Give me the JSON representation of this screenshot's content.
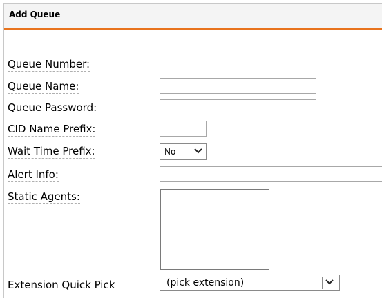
{
  "header": {
    "title": "Add Queue"
  },
  "form": {
    "queue_number": {
      "label": "Queue Number:",
      "value": ""
    },
    "queue_name": {
      "label": "Queue Name:",
      "value": ""
    },
    "queue_password": {
      "label": "Queue Password:",
      "value": ""
    },
    "cid_name_prefix": {
      "label": "CID Name Prefix:",
      "value": ""
    },
    "wait_time_prefix": {
      "label": "Wait Time Prefix:",
      "selected": "No"
    },
    "alert_info": {
      "label": "Alert Info:",
      "value": ""
    },
    "static_agents": {
      "label": "Static Agents:",
      "value": ""
    },
    "extension_quick_pick": {
      "label": "Extension Quick Pick",
      "selected": "(pick extension)"
    }
  },
  "icons": {
    "dropdown": "chevron-down-icon"
  },
  "colors": {
    "accent": "#e8731d",
    "header_bg": "#f4f4f4"
  }
}
